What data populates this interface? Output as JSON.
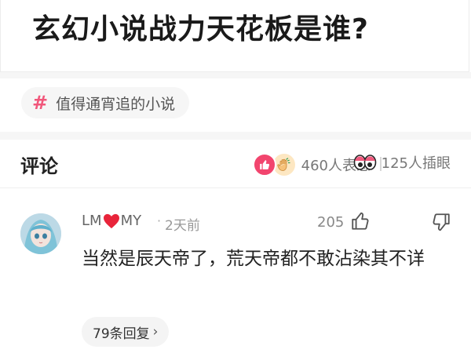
{
  "post": {
    "title": "玄幻小说战力天花板是谁?",
    "tag_label": "值得通宵追的小说"
  },
  "comments_header": {
    "title": "评论",
    "reactions_count": "460人表态",
    "eyes_count": "125人插眼"
  },
  "comment": {
    "user_name_left": "LM",
    "user_name_right": "MY",
    "dot": "·",
    "time": "2天前",
    "like_count": "205",
    "text": "当然是辰天帝了，荒天帝都不敢沾染其不详",
    "reply_label": "79条回复",
    "reply_chevron": "›"
  },
  "colors": {
    "accent": "#f1577b",
    "like_badge": "#f2456e",
    "heart": "#e8243a"
  },
  "icons": {
    "tag": "hash-icon",
    "reaction_like": "thumbs-up-badge-icon",
    "reaction_hand": "hand-badge-icon",
    "eyes": "eyes-icon",
    "like": "thumbs-up-icon",
    "dislike": "thumbs-down-icon",
    "heart": "heart-icon"
  }
}
